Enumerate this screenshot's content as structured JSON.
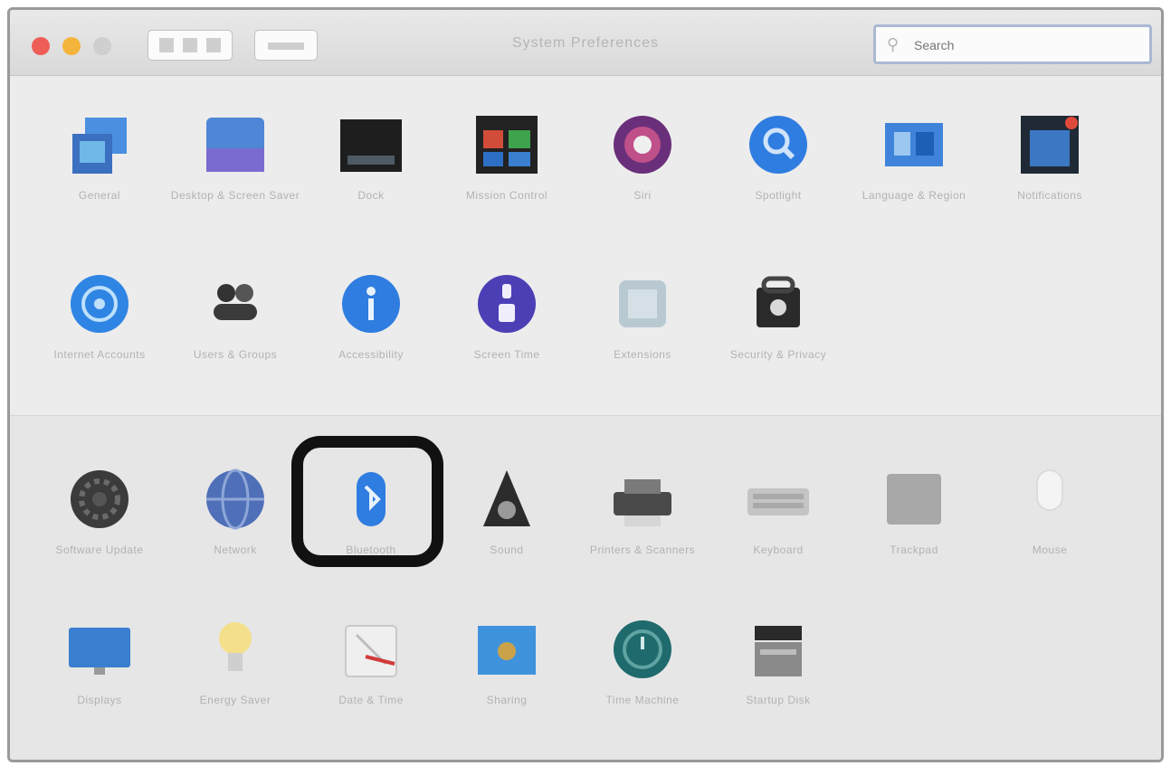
{
  "window": {
    "title": "System Preferences",
    "search_placeholder": "Search"
  },
  "colors": {
    "highlight": "#111111",
    "close": "#ee5d56",
    "minimize": "#f4b43c"
  },
  "panes": [
    {
      "label": "General",
      "icon": "general-icon"
    },
    {
      "label": "Desktop & Screen Saver",
      "icon": "desktop-screensaver-icon"
    },
    {
      "label": "Dock",
      "icon": "dock-icon"
    },
    {
      "label": "Mission Control",
      "icon": "mission-control-icon"
    },
    {
      "label": "Siri",
      "icon": "siri-icon"
    },
    {
      "label": "Spotlight",
      "icon": "spotlight-icon"
    },
    {
      "label": "Language & Region",
      "icon": "language-region-icon"
    },
    {
      "label": "Notifications",
      "icon": "notifications-icon"
    },
    {
      "label": "Internet Accounts",
      "icon": "internet-accounts-icon"
    },
    {
      "label": "Users & Groups",
      "icon": "users-groups-icon"
    },
    {
      "label": "Accessibility",
      "icon": "accessibility-icon"
    },
    {
      "label": "Screen Time",
      "icon": "screen-time-icon"
    },
    {
      "label": "Extensions",
      "icon": "extensions-icon"
    },
    {
      "label": "Security & Privacy",
      "icon": "security-privacy-icon"
    },
    {
      "label": "Software Update",
      "icon": "software-update-icon"
    },
    {
      "label": "Network",
      "icon": "network-icon"
    },
    {
      "label": "Bluetooth",
      "icon": "bluetooth-icon"
    },
    {
      "label": "Sound",
      "icon": "sound-icon"
    },
    {
      "label": "Printers & Scanners",
      "icon": "printers-scanners-icon"
    },
    {
      "label": "Keyboard",
      "icon": "keyboard-icon"
    },
    {
      "label": "Trackpad",
      "icon": "trackpad-icon"
    },
    {
      "label": "Mouse",
      "icon": "mouse-icon"
    },
    {
      "label": "Displays",
      "icon": "displays-icon"
    },
    {
      "label": "Energy Saver",
      "icon": "energy-saver-icon"
    },
    {
      "label": "Date & Time",
      "icon": "date-time-icon"
    },
    {
      "label": "Sharing",
      "icon": "sharing-icon"
    },
    {
      "label": "Time Machine",
      "icon": "time-machine-icon"
    },
    {
      "label": "Startup Disk",
      "icon": "startup-disk-icon"
    }
  ]
}
